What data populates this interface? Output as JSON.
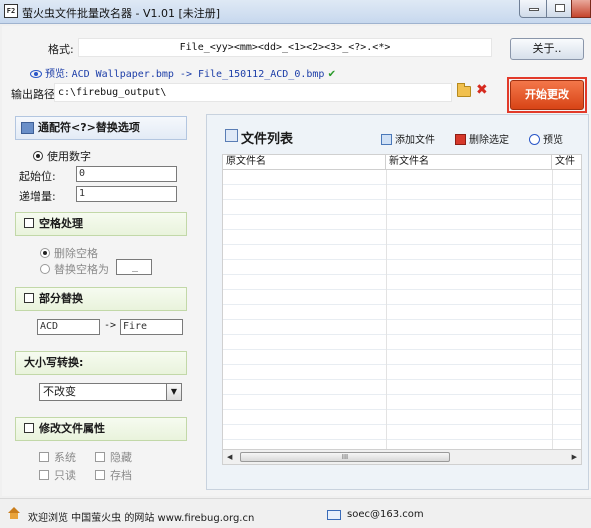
{
  "window": {
    "icon_text": "F2",
    "title": "萤火虫文件批量改名器 - V1.01 [未注册]"
  },
  "header": {
    "format_label": "格式:",
    "format_value": "File_<yy><mm><dd>_<1><2><3>_<?>.<*>",
    "preview_label": "预览:",
    "preview_value": "ACD Wallpaper.bmp -> File_150112_ACD_0.bmp",
    "output_label": "输出路径:",
    "output_value": "c:\\firebug_output\\",
    "about_button": "关于..",
    "start_button": "开始更改"
  },
  "wildcard": {
    "title": "通配符<?>替换选项",
    "use_number": "使用数字",
    "start_label": "起始位:",
    "start_value": "0",
    "step_label": "递增量:",
    "step_value": "1"
  },
  "space": {
    "title": "空格处理",
    "delete_option": "删除空格",
    "replace_option": "替换空格为",
    "replace_value": "_"
  },
  "partial": {
    "title": "部分替换",
    "from": "ACD",
    "arrow": "->",
    "to": "Fire"
  },
  "case": {
    "title": "大小写转换:",
    "selected": "不改变"
  },
  "attributes": {
    "title": "修改文件属性",
    "system": "系统",
    "hidden": "隐藏",
    "readonly": "只读",
    "archive": "存档"
  },
  "file_list": {
    "title": "文件列表",
    "add_file": "添加文件",
    "delete_selected": "删除选定",
    "preview": "预览",
    "columns": [
      "原文件名",
      "新文件名",
      "文件"
    ],
    "scrollbar_grip": "III"
  },
  "status": {
    "welcome": "欢迎浏览 中国萤火虫 的网站 www.firebug.org.cn",
    "email": "soec@163.com"
  },
  "colors": {
    "start_button": "#d84416",
    "highlight_frame": "#e23a2a",
    "preview_text": "#1d3ea8",
    "section_green": "#e9f3dc"
  }
}
